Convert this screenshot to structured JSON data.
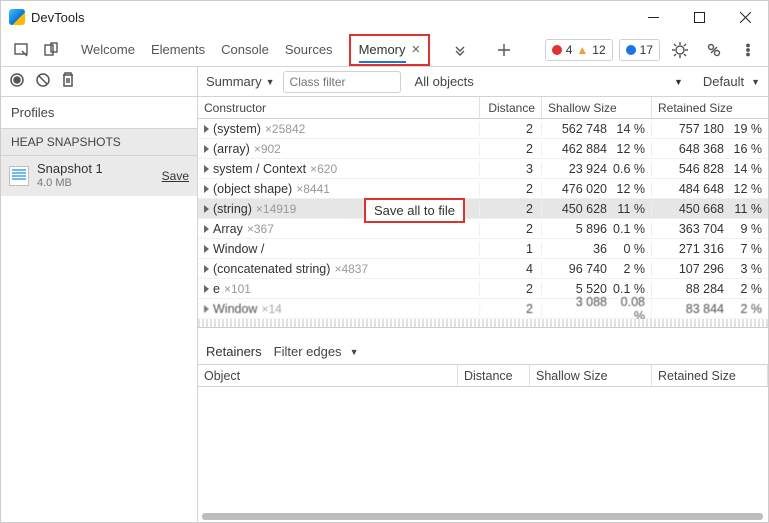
{
  "window": {
    "title": "DevTools"
  },
  "tabs": {
    "items": [
      "Welcome",
      "Elements",
      "Console",
      "Sources",
      "Memory"
    ],
    "active": "Memory"
  },
  "status": {
    "errors": "4",
    "warnings": "12",
    "info": "17"
  },
  "sidebar": {
    "profiles_label": "Profiles",
    "heap_label": "HEAP SNAPSHOTS",
    "snapshot": {
      "name": "Snapshot 1",
      "size": "4.0 MB",
      "save": "Save"
    }
  },
  "filters": {
    "summary": "Summary",
    "placeholder": "Class filter",
    "objects": "All objects",
    "default": "Default"
  },
  "grid": {
    "headers": {
      "constructor": "Constructor",
      "distance": "Distance",
      "shallow": "Shallow Size",
      "retained": "Retained Size"
    },
    "rows": [
      {
        "name": "(system)",
        "count": "×25842",
        "dist": "2",
        "sh": "562 748",
        "shp": "14 %",
        "ret": "757 180",
        "retp": "19 %"
      },
      {
        "name": "(array)",
        "count": "×902",
        "dist": "2",
        "sh": "462 884",
        "shp": "12 %",
        "ret": "648 368",
        "retp": "16 %"
      },
      {
        "name": "system / Context",
        "count": "×620",
        "dist": "3",
        "sh": "23 924",
        "shp": "0.6 %",
        "ret": "546 828",
        "retp": "14 %"
      },
      {
        "name": "(object shape)",
        "count": "×8441",
        "dist": "2",
        "sh": "476 020",
        "shp": "12 %",
        "ret": "484 648",
        "retp": "12 %"
      },
      {
        "name": "(string)",
        "count": "×14919",
        "dist": "2",
        "sh": "450 628",
        "shp": "11 %",
        "ret": "450 668",
        "retp": "11 %",
        "selected": true
      },
      {
        "name": "Array",
        "count": "×367",
        "dist": "2",
        "sh": "5 896",
        "shp": "0.1 %",
        "ret": "363 704",
        "retp": "9 %"
      },
      {
        "name": "Window /",
        "count": "",
        "dist": "1",
        "sh": "36",
        "shp": "0 %",
        "ret": "271 316",
        "retp": "7 %"
      },
      {
        "name": "(concatenated string)",
        "count": "×4837",
        "dist": "4",
        "sh": "96 740",
        "shp": "2 %",
        "ret": "107 296",
        "retp": "3 %"
      },
      {
        "name": "e",
        "count": "×101",
        "dist": "2",
        "sh": "5 520",
        "shp": "0.1 %",
        "ret": "88 284",
        "retp": "2 %"
      },
      {
        "name": "Window",
        "count": "×14",
        "dist": "2",
        "sh": "3 088",
        "shp": "0.08 %",
        "ret": "83 844",
        "retp": "2 %"
      }
    ]
  },
  "context_menu": {
    "save_all": "Save all to file"
  },
  "retainers": {
    "label": "Retainers",
    "filter": "Filter edges",
    "headers": {
      "object": "Object",
      "distance": "Distance",
      "shallow": "Shallow Size",
      "retained": "Retained Size"
    }
  }
}
